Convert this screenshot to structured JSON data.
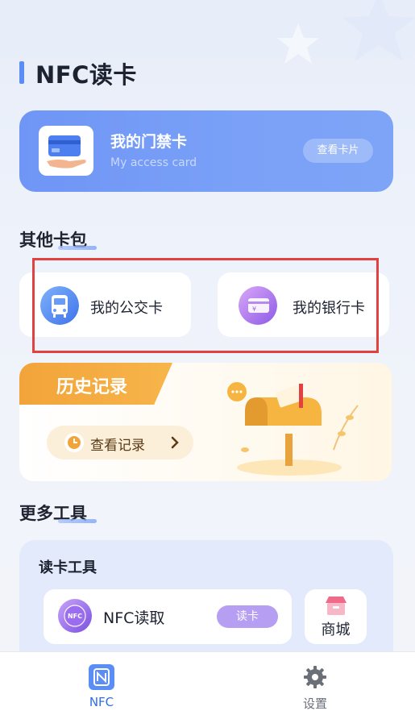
{
  "page": {
    "title": "NFC读卡"
  },
  "access_card": {
    "title": "我的门禁卡",
    "subtitle": "My access card",
    "button_label": "查看卡片",
    "icon": "hand-holding-card-icon"
  },
  "other_cards": {
    "section_title": "其他卡包",
    "items": [
      {
        "label": "我的公交卡",
        "icon": "bus-icon"
      },
      {
        "label": "我的银行卡",
        "icon": "bank-card-icon"
      }
    ]
  },
  "history": {
    "tab_label": "历史记录",
    "button_label": "查看记录",
    "icons": [
      "clock-icon",
      "chevron-right-icon",
      "mailbox-icon"
    ]
  },
  "more_tools": {
    "section_title": "更多工具",
    "card_title": "读卡工具",
    "nfc_read": {
      "label": "NFC读取",
      "button_label": "读卡",
      "icon": "nfc-icon"
    },
    "mall": {
      "label": "商城",
      "icon": "shop-icon"
    }
  },
  "bottom_nav": {
    "items": [
      {
        "label": "NFC",
        "icon": "nfc-tab-icon",
        "active": true
      },
      {
        "label": "设置",
        "icon": "gear-icon",
        "active": false
      }
    ]
  },
  "colors": {
    "accent_blue": "#6f95f6",
    "history_orange": "#f2a43a",
    "read_button_purple": "#b69ef2",
    "highlight_red": "#e34040"
  }
}
